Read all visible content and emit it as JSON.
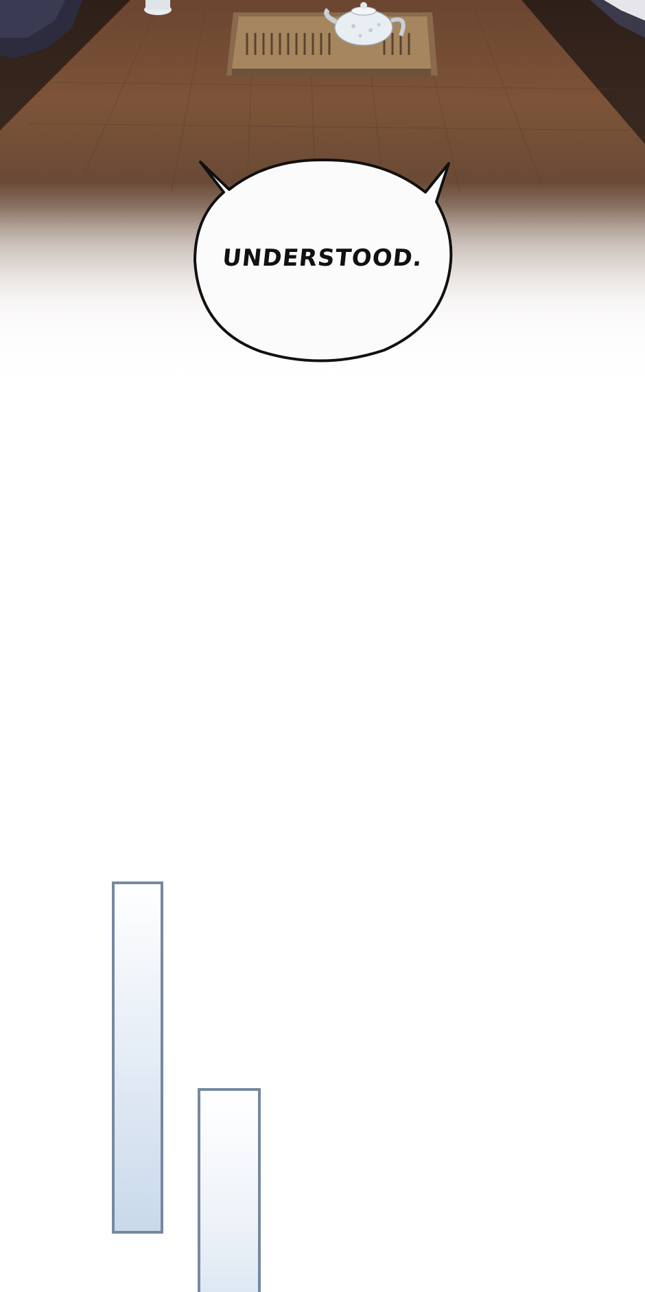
{
  "scene": {
    "description_icon": "teapot-icon"
  },
  "speech_bubble": {
    "text": "UNDERSTOOD."
  },
  "colors": {
    "table_wood": "#7a5236",
    "table_dark": "#3e2a1e",
    "frame_border": "#7589a0",
    "frame_fill": "#c9d9ea"
  }
}
